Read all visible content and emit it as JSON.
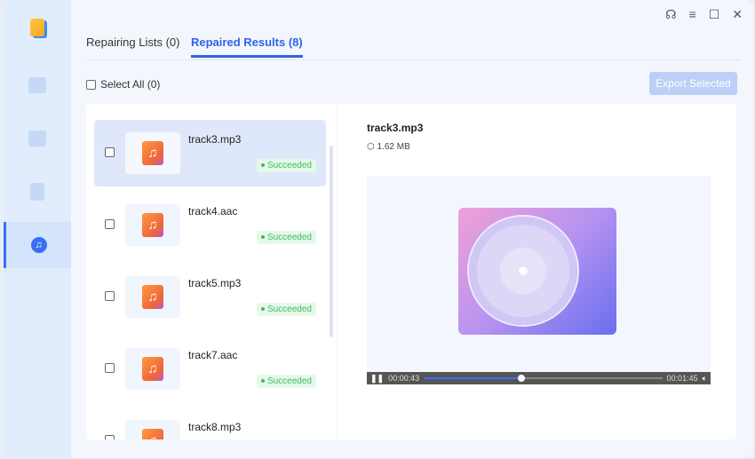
{
  "window_controls": [
    "support",
    "menu",
    "maximize",
    "close"
  ],
  "tabs": [
    {
      "label": "Repairing Lists (0)"
    },
    {
      "label": "Repaired Results (8)"
    }
  ],
  "select_all": "Select All (0)",
  "export_label": "Export Selected",
  "files": [
    {
      "name": "track3.mp3",
      "status": "Succeeded"
    },
    {
      "name": "track4.aac",
      "status": "Succeeded"
    },
    {
      "name": "track5.mp3",
      "status": "Succeeded"
    },
    {
      "name": "track7.aac",
      "status": "Succeeded"
    },
    {
      "name": "track8.mp3",
      "status": ""
    }
  ],
  "detail": {
    "title": "track3.mp3",
    "size": "1.62 MB"
  },
  "player": {
    "current": "00:00:43",
    "total": "00:01:45",
    "progress": 0.41
  },
  "colors": {
    "accent": "#2f62e8",
    "success": "#3dbb5c"
  }
}
